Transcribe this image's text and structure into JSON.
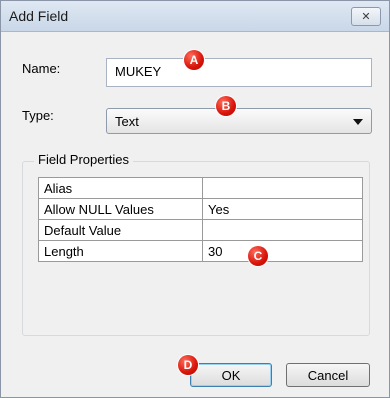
{
  "window": {
    "title": "Add Field",
    "close_glyph": "✕"
  },
  "name_field": {
    "label": "Name:",
    "value": "MUKEY"
  },
  "type_field": {
    "label": "Type:",
    "selected": "Text"
  },
  "field_properties": {
    "title": "Field Properties",
    "rows": [
      {
        "property": "Alias",
        "value": ""
      },
      {
        "property": "Allow NULL Values",
        "value": "Yes"
      },
      {
        "property": "Default Value",
        "value": ""
      },
      {
        "property": "Length",
        "value": "30"
      }
    ]
  },
  "buttons": {
    "ok": "OK",
    "cancel": "Cancel"
  },
  "markers": {
    "a": "A",
    "b": "B",
    "c": "C",
    "d": "D",
    "color": "#d8140a"
  }
}
